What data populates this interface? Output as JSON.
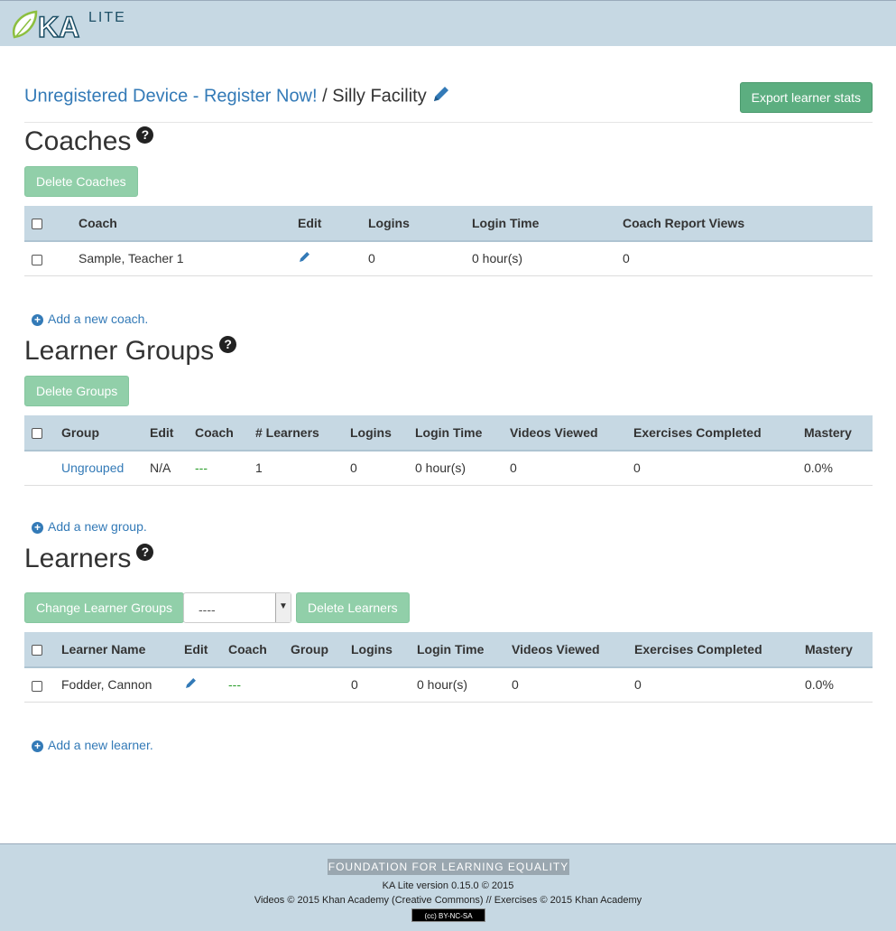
{
  "header": {
    "logo_text": "KA LITE"
  },
  "breadcrumb": {
    "device_link": "Unregistered Device - Register Now!",
    "separator": " / ",
    "facility": "Silly Facility"
  },
  "export_button": "Export learner stats",
  "coaches": {
    "title": "Coaches",
    "delete_button": "Delete Coaches",
    "columns": [
      "Coach",
      "Edit",
      "Logins",
      "Login Time",
      "Coach Report Views"
    ],
    "rows": [
      {
        "name": "Sample, Teacher 1",
        "logins": "0",
        "login_time": "0 hour(s)",
        "report_views": "0"
      }
    ],
    "add_link": "Add a new coach."
  },
  "groups": {
    "title": "Learner Groups",
    "delete_button": "Delete Groups",
    "columns": [
      "Group",
      "Edit",
      "Coach",
      "# Learners",
      "Logins",
      "Login Time",
      "Videos Viewed",
      "Exercises Completed",
      "Mastery"
    ],
    "rows": [
      {
        "group": "Ungrouped",
        "edit": "N/A",
        "coach": "---",
        "learners": "1",
        "logins": "0",
        "login_time": "0 hour(s)",
        "videos": "0",
        "exercises": "0",
        "mastery": "0.0%"
      }
    ],
    "add_link": "Add a new group."
  },
  "learners": {
    "title": "Learners",
    "change_button": "Change Learner Groups",
    "select_value": "----",
    "delete_button": "Delete Learners",
    "columns": [
      "Learner Name",
      "Edit",
      "Coach",
      "Group",
      "Logins",
      "Login Time",
      "Videos Viewed",
      "Exercises Completed",
      "Mastery"
    ],
    "rows": [
      {
        "name": "Fodder, Cannon",
        "coach": "---",
        "group": "",
        "logins": "0",
        "login_time": "0 hour(s)",
        "videos": "0",
        "exercises": "0",
        "mastery": "0.0%"
      }
    ],
    "add_link": "Add a new learner."
  },
  "footer": {
    "fle": "FOUNDATION FOR LEARNING EQUALITY",
    "version": "KA Lite version 0.15.0 © 2015",
    "credits": "Videos © 2015 Khan Academy (Creative Commons) // Exercises © 2015 Khan Academy",
    "license": "BY-NC-SA"
  },
  "colors": {
    "header_bg": "#c6d8e3",
    "link": "#337ab7",
    "primary_btn": "#5cae80",
    "disabled_btn": "#91cfa9"
  }
}
